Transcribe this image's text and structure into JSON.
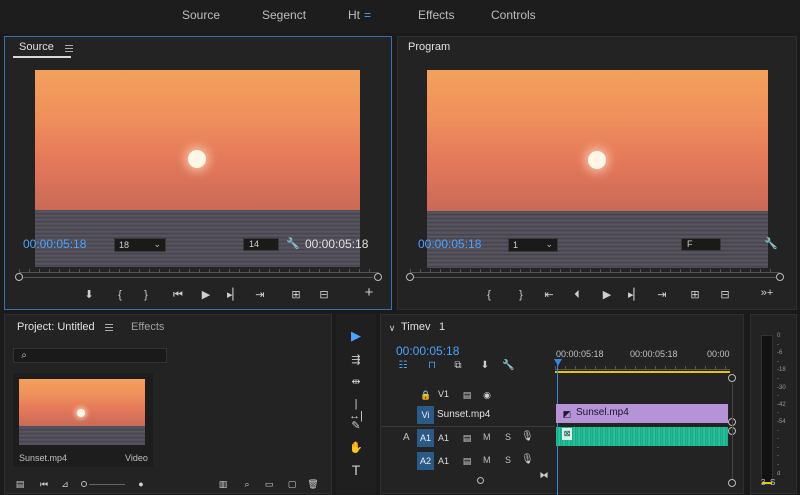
{
  "workspace_tabs": [
    "Source",
    "Segenct",
    "Ht",
    "Effects",
    "Controls"
  ],
  "workspace_tab_menu": "=",
  "source": {
    "tab": "Source",
    "timecode_left": "00:00:05:18",
    "zoom": "18",
    "field_box": "14",
    "timecode_right": "00:00:05:18"
  },
  "program": {
    "tab": "Program",
    "timecode_left": "00:00:05:18",
    "zoom": "1",
    "field_box": "F"
  },
  "project": {
    "tab": "Project: Untitled",
    "effects_tab": "Effects",
    "clip_name": "Sunset.mp4",
    "clip_type": "Video"
  },
  "timeline": {
    "title": "Timev",
    "count": "1",
    "timecode": "00:00:05:18",
    "ruler_labels": [
      "00:00:05:18",
      "00:00:05:18",
      "00:00"
    ],
    "tracks": {
      "v1": "V1",
      "vi": "Vi",
      "a_label": "A",
      "a1_target": "A1",
      "a1": "A1",
      "a2_target": "A2",
      "a1_b": "A1",
      "m": "M",
      "s": "S"
    },
    "video_clip": "Sunsel.mp4",
    "track_clip_label": "Sunset.mp4"
  },
  "meter": {
    "labels": [
      "0",
      "-",
      "-6",
      "-",
      "-18",
      "-",
      "-30",
      "-",
      "-42",
      "-",
      "-54",
      "-",
      "-",
      "-",
      "-",
      "-",
      "d"
    ],
    "bottom": [
      "3",
      "S"
    ]
  },
  "colors": {
    "accent_blue": "#4aa3ff",
    "clip_video": "#b693d6",
    "clip_audio": "#22c29b",
    "playhead": "#3a86d8"
  }
}
